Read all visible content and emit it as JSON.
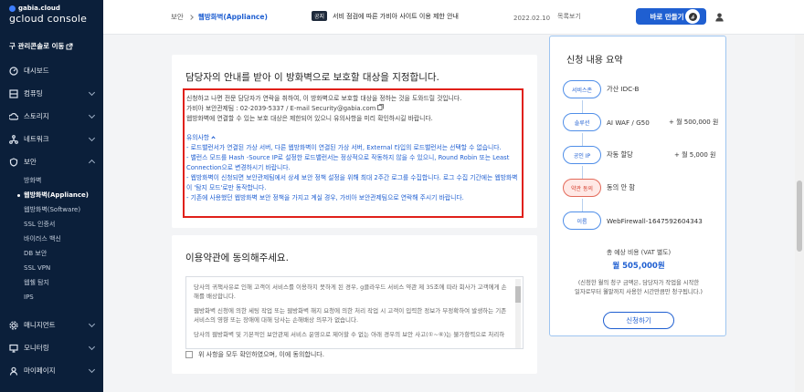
{
  "sidebar": {
    "brand_top": "gabia.cloud",
    "brand_main": "gcloud console",
    "legacy_link": "구 관리콘솔로 이동",
    "items": [
      {
        "label": "대시보드",
        "icon": "dashboard-icon",
        "has_chevron": false
      },
      {
        "label": "컴퓨팅",
        "icon": "server-icon",
        "has_chevron": true
      },
      {
        "label": "스토리지",
        "icon": "cloud-icon",
        "has_chevron": true
      },
      {
        "label": "네트워크",
        "icon": "network-icon",
        "has_chevron": true
      },
      {
        "label": "보안",
        "icon": "shield-icon",
        "has_chevron": true,
        "expanded": true
      }
    ],
    "security_sub": [
      "방화벽",
      "웹방화벽(Appliance)",
      "웹방화벽(Software)",
      "SSL 인증서",
      "바이러스 백신",
      "DB 보안",
      "SSL VPN",
      "웹쉘 탐지",
      "IPS"
    ],
    "bottom_items": [
      {
        "label": "매니지먼트",
        "icon": "gear-icon"
      },
      {
        "label": "모니터링",
        "icon": "monitor-icon"
      },
      {
        "label": "마이페이지",
        "icon": "user-icon"
      }
    ]
  },
  "header": {
    "breadcrumb_root": "보안",
    "breadcrumb_current": "웹방화벽(Appliance)",
    "notice_badge": "공지",
    "notice_text": "서비 점검에 따른 가비아 사이트 이용 제한 안내",
    "notice_date": "2022.02.10",
    "notice_more": "목록보기",
    "create_button": "바로 만들기"
  },
  "guide_card": {
    "title": "담당자의 안내를 받아 이 방화벽으로 보호할 대상을 지정합니다.",
    "lines": [
      "신청하고 나면 전문 담당자가 연락을 취하여, 이 방화벽으로 보호할 대상을 정하는 것을 도와드릴 것입니다.",
      "가비아 보안관제팀 : 02-2039-5337 / E-mail Security@gabia.com",
      "웹방화벽에 연결할 수 있는 보호 대상은 제한되어 있으니 유의사항을 미리 확인하시길 바랍니다."
    ],
    "caution_title": "유의사항",
    "caution_lines": [
      "- 로드밸런서가 연결된 가상 서버, 다른 웹방화벽이 연결된 가상 서버, External 타입의 로드밸런서는 선택할 수 없습니다.",
      "- 밸런스 모드를 Hash -Source IP로 설정한 로드밸런서는 정상적으로 작동하지 않을 수 있으니, Round Robin 또는 Least Connection으로 변경하시기 바랍니다.",
      "- 웹방화벽이 신청되면 보안관제팀에서 상세 보안 정책 설정을 위해 최대 2주간 로그를 수집합니다. 로그 수집 기간에는 웹방화벽이 '탐지 모드'로만 동작합니다.",
      "- 기존에 사용했던 웹방화벽 보안 정책을 가지고 계실 경우, 가비아 보안관제팀으로 연락해 주시기 바랍니다."
    ]
  },
  "terms_card": {
    "title": "이용약관에 동의해주세요.",
    "paragraphs": [
      "당사의 귀책사유로 인해 고객이 서비스를 이용하지 못하게 된 경우, g클라우드 서비스 약관 제 35조에 따라 회사가 고객에게 손해를 배상합니다.",
      "웹방화벽 신청에 의한 세팅 작업 또는 웹방화벽 해지 요청에 의한 처리 작업 시 고객이 입력한 정보가 부정확하여 발생하는 기존 서비스의 영향 또는 장애에 대해 당사는 손해배상 의무가 없습니다.",
      "당사의 웹방화벽 및 기본적인 보안관제 서비스 운영으로 제어할 수 없는 아래 경우의 보안 사고(①~⑥)는 불가항력으로 처리하"
    ],
    "agree_label": "위 사항을 모두 확인하였으며, 이에 동의합니다."
  },
  "summary": {
    "title": "신청 내용 요약",
    "rows": [
      {
        "tag": "서비스존",
        "value": "가산 IDC-B",
        "price": ""
      },
      {
        "tag": "솔루션",
        "value": "AI WAF / G50",
        "price": "+ 월 500,000 원"
      },
      {
        "tag": "공인 IP",
        "value": "자동 할당",
        "price": "+ 월 5,000 원"
      },
      {
        "tag": "약관 동의",
        "value": "동의 안 함",
        "price": "",
        "warn": true
      },
      {
        "tag": "이름",
        "value": "WebFirewall-1647592604343",
        "price": ""
      }
    ],
    "total_label": "총 예상 비용 (VAT 별도)",
    "total_value": "월 505,000원",
    "note_line1": "(신청한 월의 청구 금액은, 담당자가 작업을 시작한",
    "note_line2": "일자로부터 월말까지 사용한 시간만큼만 청구됩니다.)",
    "apply_button": "신청하기"
  },
  "colors": {
    "sidebar_bg": "#0b1f3a",
    "accent": "#1f5fd1",
    "highlight_border": "#e0201a"
  }
}
